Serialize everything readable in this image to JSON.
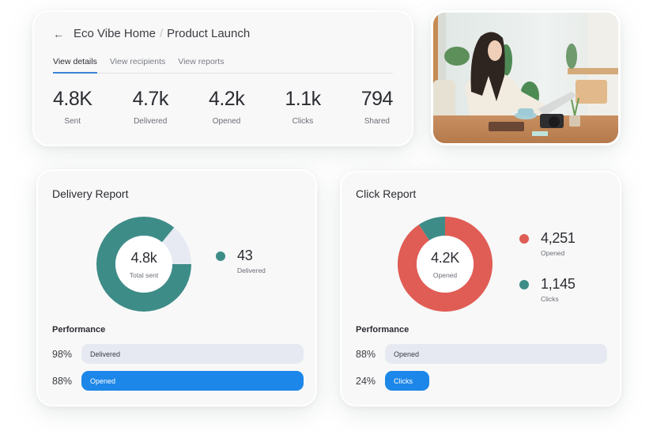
{
  "summary": {
    "back_icon": "arrow-left-icon",
    "breadcrumb": {
      "parent": "Eco Vibe Home",
      "separator": "/",
      "current": "Product Launch"
    },
    "tabs": [
      {
        "label": "View details",
        "active": true
      },
      {
        "label": "View recipients",
        "active": false
      },
      {
        "label": "View reports",
        "active": false
      }
    ],
    "stats": [
      {
        "value": "4.8K",
        "label": "Sent"
      },
      {
        "value": "4.7k",
        "label": "Delivered"
      },
      {
        "value": "4.2k",
        "label": "Opened"
      },
      {
        "value": "1.1k",
        "label": "Clicks"
      },
      {
        "value": "794",
        "label": "Shared"
      }
    ]
  },
  "photo": {
    "alt": "Woman working on laptop at a wooden desk with coffee, camera and plant"
  },
  "colors": {
    "teal": "#3d8c88",
    "red": "#e05d55",
    "light": "#e7eaf2",
    "blue": "#1c87e8"
  },
  "delivery_report": {
    "title": "Delivery Report",
    "donut": {
      "center_value": "4.8k",
      "center_label": "Total sent",
      "segments": [
        {
          "name": "Delivered",
          "fraction": 0.86,
          "color": "#3d8c88"
        },
        {
          "name": "Remaining",
          "fraction": 0.14,
          "color": "#e7eaf2"
        }
      ]
    },
    "legend": [
      {
        "value": "43",
        "label": "Delivered",
        "color": "#3d8c88"
      }
    ],
    "performance_title": "Performance",
    "performance": [
      {
        "percent_label": "98%",
        "label": "Delivered",
        "fill": 1.0,
        "style": "gray"
      },
      {
        "percent_label": "88%",
        "label": "Opened",
        "fill": 1.0,
        "style": "blue"
      }
    ]
  },
  "click_report": {
    "title": "Click Report",
    "donut": {
      "center_value": "4.2K",
      "center_label": "Opened",
      "segments": [
        {
          "name": "Opened",
          "fraction": 0.907,
          "color": "#e05d55"
        },
        {
          "name": "Clicks",
          "fraction": 0.093,
          "color": "#3d8c88"
        }
      ]
    },
    "legend": [
      {
        "value": "4,251",
        "label": "Opened",
        "color": "#e05d55"
      },
      {
        "value": "1,145",
        "label": "Clicks",
        "color": "#3d8c88"
      }
    ],
    "performance_title": "Performance",
    "performance": [
      {
        "percent_label": "88%",
        "label": "Opened",
        "fill": 1.0,
        "style": "gray"
      },
      {
        "percent_label": "24%",
        "label": "Clicks",
        "fill": 0.2,
        "style": "blue"
      }
    ]
  }
}
